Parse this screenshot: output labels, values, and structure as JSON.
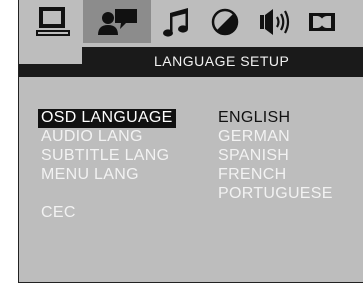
{
  "header": {
    "title": "LANGUAGE  SETUP"
  },
  "tabs": [
    {
      "icon": "monitor-icon"
    },
    {
      "icon": "language-speech-icon",
      "active": true
    },
    {
      "icon": "music-note-icon"
    },
    {
      "icon": "half-circle-icon"
    },
    {
      "icon": "speaker-icon"
    },
    {
      "icon": "dolby-icon"
    }
  ],
  "menu": {
    "items": [
      {
        "label": "OSD LANGUAGE",
        "selected": true
      },
      {
        "label": "AUDIO LANG"
      },
      {
        "label": "SUBTITLE  LANG"
      },
      {
        "label": "MENU LANG"
      },
      {
        "label": "CEC"
      }
    ]
  },
  "options": {
    "items": [
      {
        "label": "ENGLISH",
        "current": true
      },
      {
        "label": "GERMAN"
      },
      {
        "label": "SPANISH"
      },
      {
        "label": "FRENCH"
      },
      {
        "label": "PORTUGUESE"
      }
    ]
  },
  "colors": {
    "background": "#bdbdbd",
    "header": "#1a1a1a",
    "active_tab": "#8c8c8c",
    "text_light": "#f2f2f2",
    "text_dark": "#111111"
  }
}
